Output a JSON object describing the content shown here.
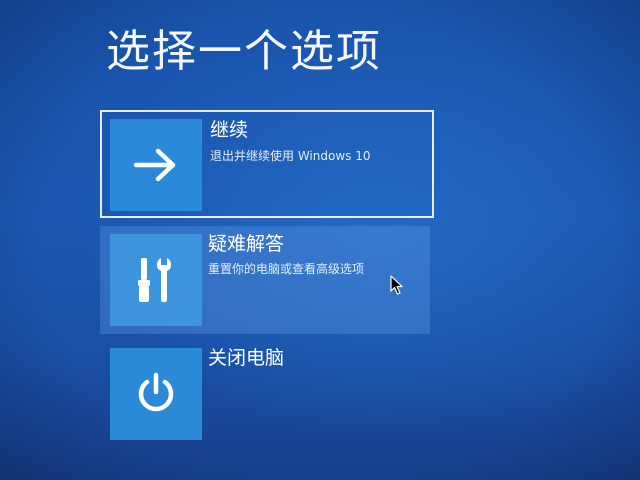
{
  "screen": {
    "title": "选择一个选项"
  },
  "options": [
    {
      "title": "继续",
      "subtitle": "退出并继续使用 Windows 10",
      "icon": "arrow-right-icon",
      "state": "focused"
    },
    {
      "title": "疑难解答",
      "subtitle": "重置你的电脑或查看高级选项",
      "icon": "tools-icon",
      "state": "hovered"
    },
    {
      "title": "关闭电脑",
      "subtitle": "",
      "icon": "power-icon",
      "state": "normal"
    }
  ],
  "colors": {
    "background": "#1a55ad",
    "tile": "#2b8ad8",
    "focus_border": "#e8eef8",
    "hover_background": "#4f8fd8"
  }
}
